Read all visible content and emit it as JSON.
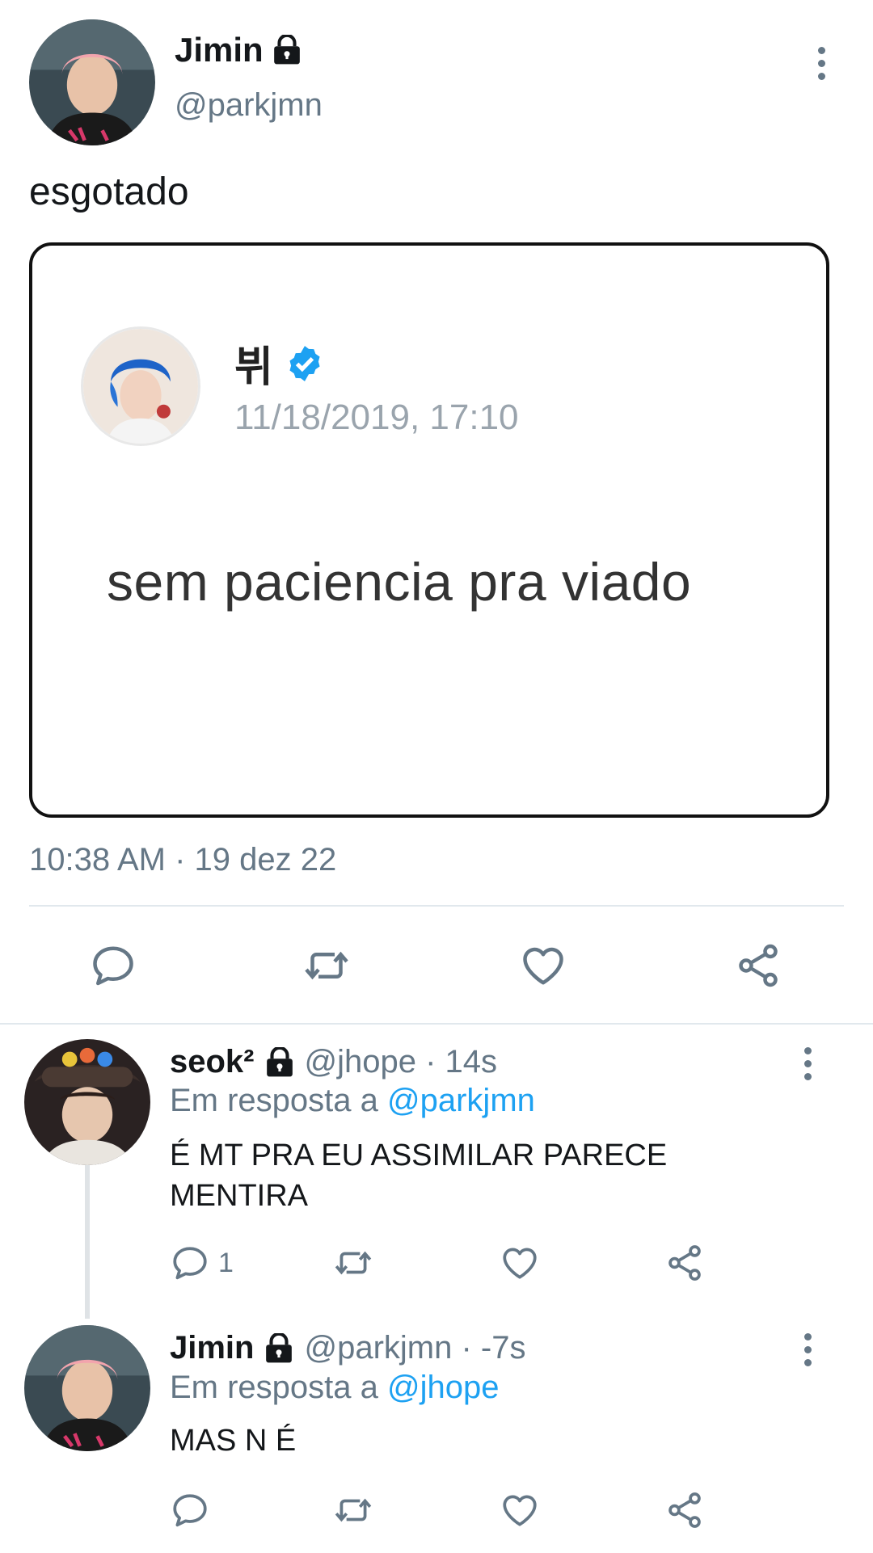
{
  "main_tweet": {
    "display_name": "Jimin",
    "handle": "@parkjmn",
    "text": "esgotado",
    "timestamp": "10:38 AM · 19 dez 22",
    "embedded": {
      "name": "뷔",
      "date": "11/18/2019, 17:10",
      "text": "sem paciencia pra viado"
    }
  },
  "replies": [
    {
      "display_name": "seok²",
      "meta": "@jhope · 14s",
      "reply_prefix": "Em resposta a",
      "reply_to": "@parkjmn",
      "text": "É MT PRA EU ASSIMILAR PARECE MENTIRA",
      "reply_count": "1"
    },
    {
      "display_name": "Jimin",
      "meta": "@parkjmn · -7s",
      "reply_prefix": "Em resposta a",
      "reply_to": "@jhope",
      "text": "MAS N É"
    }
  ],
  "icons": {
    "lock": "lock-icon",
    "verified": "verified-icon",
    "reply": "reply-icon",
    "retweet": "retweet-icon",
    "like": "heart-icon",
    "share": "share-icon",
    "more": "more-vertical-icon"
  },
  "colors": {
    "link": "#1da1f2",
    "muted": "#657786",
    "verified": "#1da1f2",
    "divider": "#e1e8ed"
  }
}
